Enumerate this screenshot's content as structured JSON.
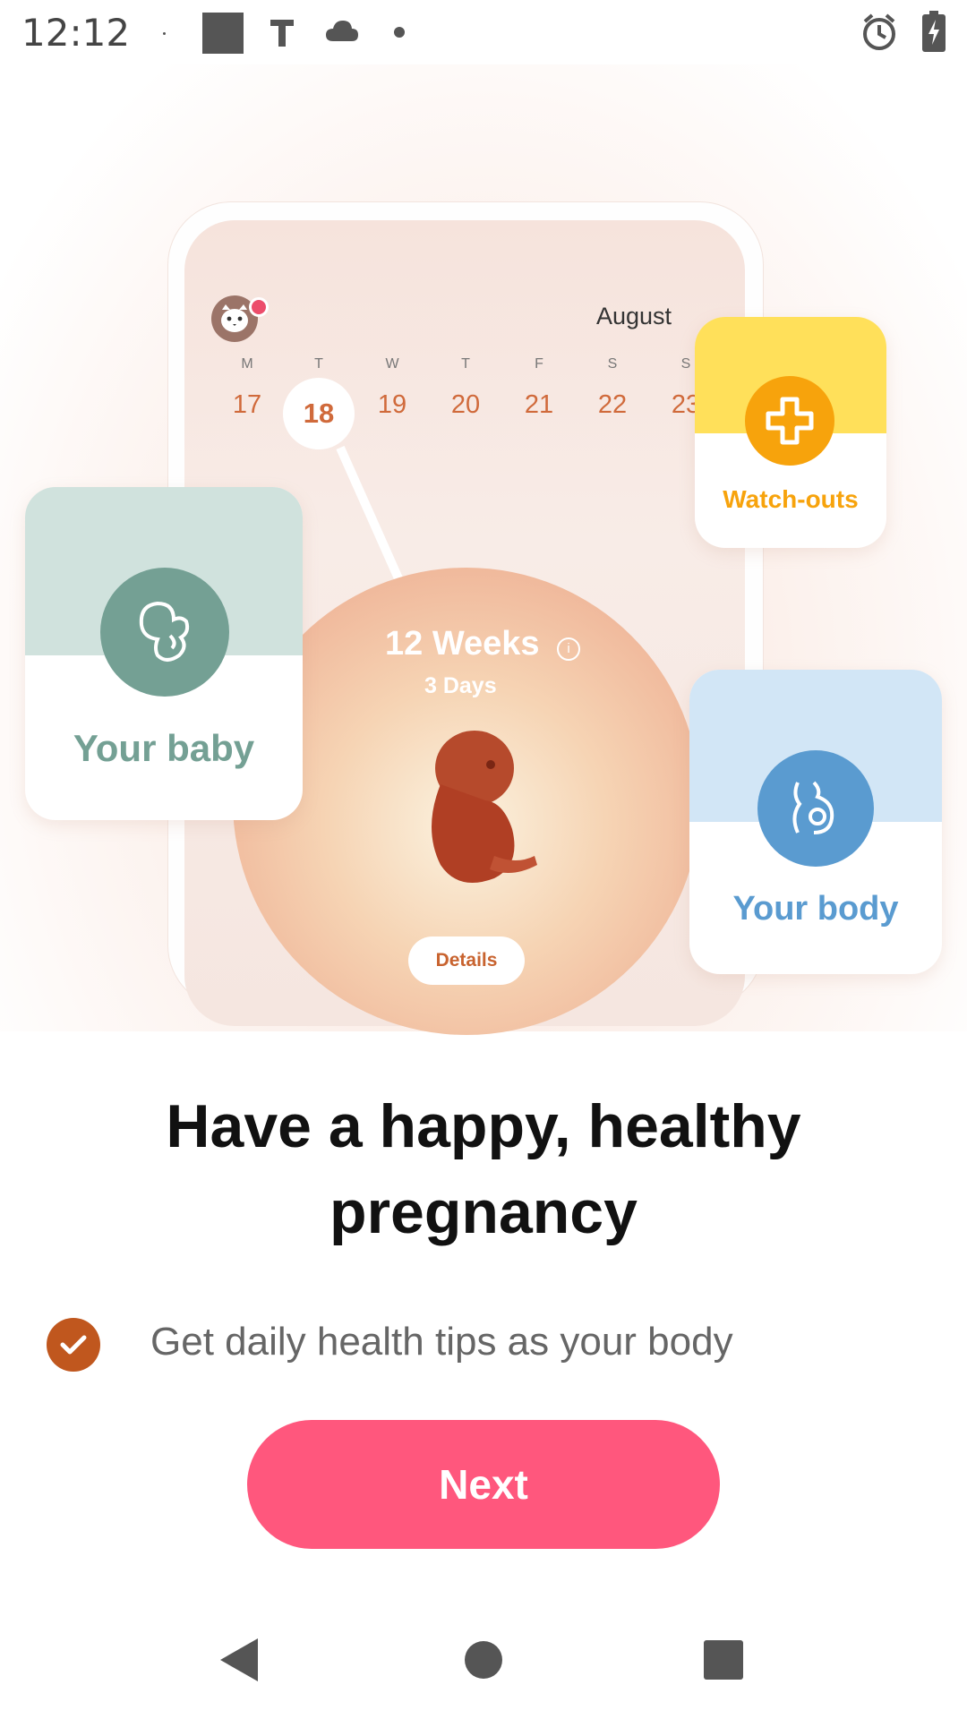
{
  "status_bar": {
    "time": "12:12"
  },
  "illustration": {
    "calendar": {
      "month": "August",
      "weekdays": [
        "M",
        "T",
        "W",
        "T",
        "F",
        "S",
        "S"
      ],
      "days": [
        "17",
        "18",
        "19",
        "20",
        "21",
        "22",
        "23"
      ],
      "selected_day": "18"
    },
    "progress": {
      "weeks": "12 Weeks",
      "days": "3 Days",
      "details_label": "Details"
    },
    "cards": {
      "baby": {
        "label": "Your baby",
        "color": "#74a094"
      },
      "watch": {
        "label": "Watch-outs",
        "color": "#f7a30c"
      },
      "body": {
        "label": "Your body",
        "color": "#5a9bd0"
      }
    }
  },
  "onboarding": {
    "headline": "Have a happy, healthy pregnancy",
    "tip": "Get daily health tips as your body",
    "next_label": "Next"
  },
  "colors": {
    "accent": "#ff577d",
    "check": "#c0571e"
  }
}
